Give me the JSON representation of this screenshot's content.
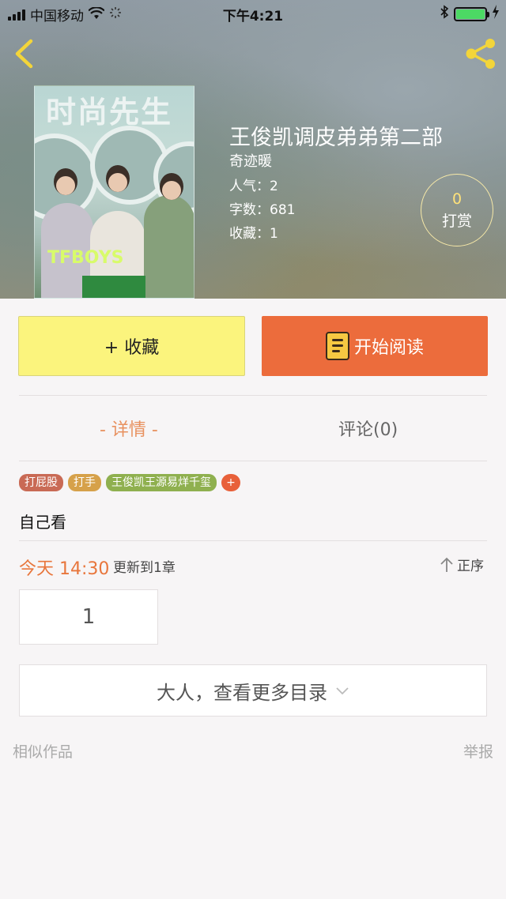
{
  "status_bar": {
    "carrier": "中国移动",
    "time": "下午4:21"
  },
  "nav": {
    "back_icon": "chevron-left-icon",
    "share_icon": "share-icon"
  },
  "book": {
    "cover_title": "时尚先生",
    "cover_band": "TFBOYS",
    "title": "王俊凯调皮弟弟第二部",
    "author": "奇迹暖",
    "popularity": "人气：2",
    "word_count": "字数：681",
    "favorites": "收藏：1"
  },
  "reward": {
    "count": "0",
    "label": "打赏"
  },
  "actions": {
    "favorite_label": "+ 收藏",
    "read_label": "开始阅读"
  },
  "tabs": {
    "detail": "- 详情 -",
    "comments": "评论(0)"
  },
  "tags": [
    {
      "label": "打屁股",
      "color": "#c96a55"
    },
    {
      "label": "打手",
      "color": "#d6a14a"
    },
    {
      "label": "王俊凯王源易烊千玺",
      "color": "#8fb04f"
    }
  ],
  "tag_add": "+",
  "description": "自己看",
  "update": {
    "time": "今天 14:30",
    "text": "更新到1章",
    "order_label": "正序"
  },
  "chapter": "1",
  "more_toc": "大人，查看更多目录",
  "footer": {
    "similar": "相似作品",
    "report": "举报"
  },
  "colors": {
    "accent_orange": "#ec6c3c",
    "fav_yellow": "#fbf47d",
    "reward_gold": "#ffe27a"
  }
}
